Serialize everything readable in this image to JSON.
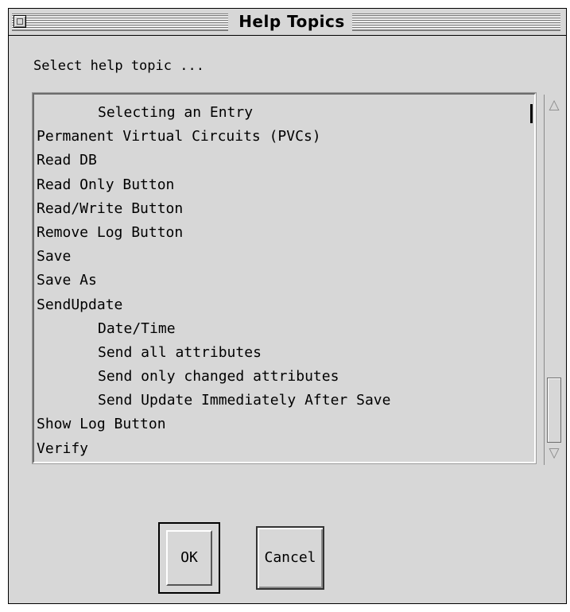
{
  "window": {
    "title": "Help Topics"
  },
  "prompt": "Select help topic ...",
  "topics": [
    {
      "label": "Selecting an Entry",
      "indent": true
    },
    {
      "label": "Permanent Virtual Circuits (PVCs)",
      "indent": false
    },
    {
      "label": "Read DB",
      "indent": false
    },
    {
      "label": "Read Only Button",
      "indent": false
    },
    {
      "label": "Read/Write Button",
      "indent": false
    },
    {
      "label": "Remove Log Button",
      "indent": false
    },
    {
      "label": "Save",
      "indent": false
    },
    {
      "label": "Save As",
      "indent": false
    },
    {
      "label": "SendUpdate",
      "indent": false
    },
    {
      "label": "Date/Time",
      "indent": true
    },
    {
      "label": "Send all attributes",
      "indent": true
    },
    {
      "label": "Send only changed attributes",
      "indent": true
    },
    {
      "label": "Send Update Immediately After Save",
      "indent": true
    },
    {
      "label": "Show Log Button",
      "indent": false
    },
    {
      "label": "Verify",
      "indent": false
    }
  ],
  "buttons": {
    "ok": "OK",
    "cancel": "Cancel"
  },
  "scrollbar": {
    "up_icon": "triangle-up-icon",
    "down_icon": "triangle-down-icon",
    "position": "bottom"
  }
}
